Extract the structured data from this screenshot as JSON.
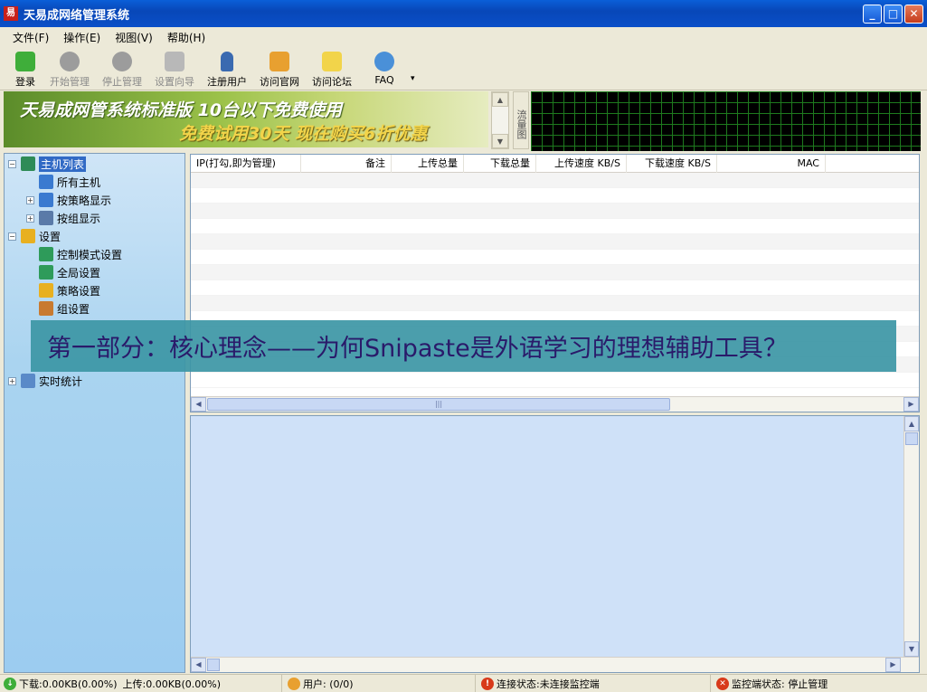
{
  "window": {
    "title": "天易成网络管理系统",
    "app_icon_glyph": "易",
    "buttons": {
      "minimize": "_",
      "maximize": "□",
      "close": "✕"
    }
  },
  "menu": [
    "文件(F)",
    "操作(E)",
    "视图(V)",
    "帮助(H)"
  ],
  "toolbar": [
    {
      "label": "登录",
      "icon": "login-icon",
      "enabled": true,
      "color": "#3fae3a"
    },
    {
      "label": "开始管理",
      "icon": "start-icon",
      "enabled": false,
      "color": "#9c9c9c"
    },
    {
      "label": "停止管理",
      "icon": "stop-icon",
      "enabled": false,
      "color": "#9c9c9c"
    },
    {
      "label": "设置向导",
      "icon": "wizard-icon",
      "enabled": false,
      "color": "#b0b0b0"
    },
    {
      "label": "注册用户",
      "icon": "register-icon",
      "enabled": true,
      "color": "#3a6ab0"
    },
    {
      "label": "访问官网",
      "icon": "home-icon",
      "enabled": true,
      "color": "#e8a030"
    },
    {
      "label": "访问论坛",
      "icon": "forum-icon",
      "enabled": true,
      "color": "#f2d44a"
    },
    {
      "label": "FAQ",
      "icon": "faq-icon",
      "enabled": true,
      "color": "#4a90d8"
    }
  ],
  "toolbar_more": "▾",
  "banner": {
    "line1": "天易成网管系统标准版 10台以下免费使用",
    "line2": "免费试用30天 现在购买6折优惠"
  },
  "flow_tab": "流量图",
  "tree": [
    {
      "key": "host-list",
      "label": "主机列表",
      "expander": "−",
      "selected": true,
      "icon": "host-list-icon",
      "color": "#2e8b57"
    },
    {
      "key": "all-hosts",
      "label": "所有主机",
      "expander": "",
      "selected": false,
      "icon": "computer-icon",
      "color": "#3a7ad0"
    },
    {
      "key": "by-policy",
      "label": "按策略显示",
      "expander": "+",
      "selected": false,
      "icon": "monitor-icon",
      "color": "#3a7ad0"
    },
    {
      "key": "by-group",
      "label": "按组显示",
      "expander": "+",
      "selected": false,
      "icon": "group-monitor-icon",
      "color": "#5a7aa8"
    },
    {
      "key": "settings",
      "label": "设置",
      "expander": "−",
      "selected": false,
      "icon": "settings-icon",
      "color": "#e8b020"
    },
    {
      "key": "control-mode",
      "label": "控制模式设置",
      "expander": "",
      "selected": false,
      "icon": "control-mode-icon",
      "color": "#2e9b5a"
    },
    {
      "key": "global-settings",
      "label": "全局设置",
      "expander": "",
      "selected": false,
      "icon": "global-icon",
      "color": "#2e9b5a"
    },
    {
      "key": "policy-settings",
      "label": "策略设置",
      "expander": "",
      "selected": false,
      "icon": "policy-icon",
      "color": "#e8b020"
    },
    {
      "key": "group-settings",
      "label": "组设置",
      "expander": "",
      "selected": false,
      "icon": "group-icon",
      "color": "#c87a30"
    },
    {
      "key": "realtime-stats",
      "label": "实时统计",
      "expander": "+",
      "selected": false,
      "icon": "stats-icon",
      "color": "#5a8ac8"
    }
  ],
  "table": {
    "columns": [
      "IP(打勾,即为管理)",
      "备注",
      "上传总量",
      "下载总量",
      "上传速度 KB/S",
      "下载速度 KB/S",
      "MAC"
    ],
    "rows": []
  },
  "status": {
    "download": "下载:0.00KB(0.00%)",
    "upload": "上传:0.00KB(0.00%)",
    "users": "用户: (0/0)",
    "connection": "连接状态:未连接监控端",
    "monitor": "监控端状态: 停止管理"
  },
  "overlay_caption": "第一部分：核心理念——为何Snipaste是外语学习的理想辅助工具？"
}
